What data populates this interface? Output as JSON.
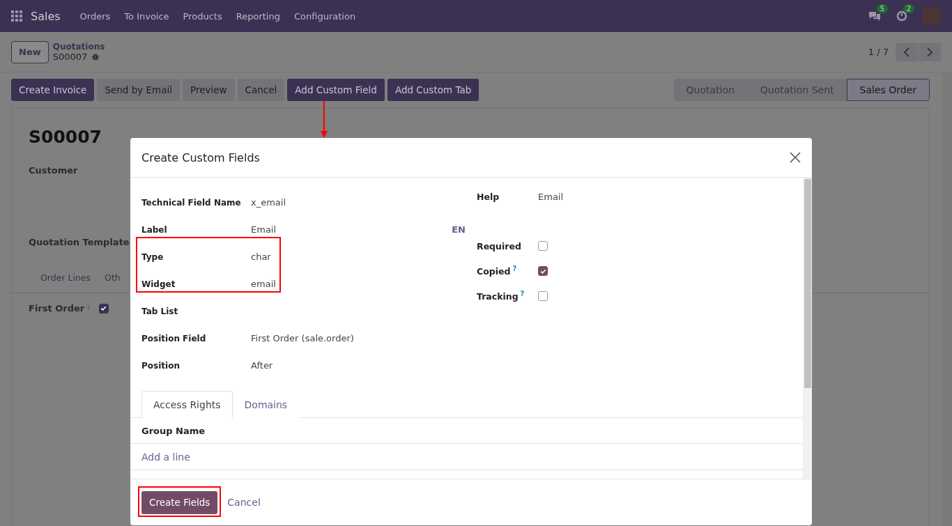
{
  "navbar": {
    "app": "Sales",
    "menu": [
      "Orders",
      "To Invoice",
      "Products",
      "Reporting",
      "Configuration"
    ],
    "messages_count": "5",
    "activities_count": "2"
  },
  "breadcrumb": {
    "new_button": "New",
    "parent": "Quotations",
    "record": "S00007"
  },
  "pager": {
    "value": "1 / 7"
  },
  "action_buttons": [
    {
      "label": "Create Invoice",
      "kind": "primary"
    },
    {
      "label": "Send by Email",
      "kind": "secondary"
    },
    {
      "label": "Preview",
      "kind": "secondary"
    },
    {
      "label": "Cancel",
      "kind": "secondary"
    },
    {
      "label": "Add Custom Field",
      "kind": "primary"
    },
    {
      "label": "Add Custom Tab",
      "kind": "primary"
    }
  ],
  "statusbar": [
    {
      "label": "Quotation",
      "selected": false
    },
    {
      "label": "Quotation Sent",
      "selected": false
    },
    {
      "label": "Sales Order",
      "selected": true
    }
  ],
  "form": {
    "title": "S00007",
    "fields": [
      "Customer",
      "Quotation Template"
    ],
    "tabs": [
      "Order Lines",
      "Oth"
    ],
    "first_order": {
      "label": "First Order",
      "help": "?",
      "checked": true
    }
  },
  "dialog": {
    "title": "Create Custom Fields",
    "fields": [
      {
        "label": "Technical Field Name",
        "value": "x_email"
      },
      {
        "label": "Label",
        "value": "Email",
        "lang": "EN"
      },
      {
        "label": "Type",
        "value": "char"
      },
      {
        "label": "Widget",
        "value": "email"
      },
      {
        "label": "Tab List"
      },
      {
        "label": "Position Field",
        "value": "First Order (sale.order)"
      },
      {
        "label": "Position",
        "value": "After"
      }
    ],
    "help": {
      "label": "Help",
      "value": "Email"
    },
    "toggles": [
      {
        "label": "Required",
        "checked": false
      },
      {
        "label": "Copied",
        "help": "?",
        "checked": true
      },
      {
        "label": "Tracking",
        "help": "?",
        "checked": false
      }
    ],
    "tabs": [
      {
        "label": "Access Rights",
        "selected": true
      },
      {
        "label": "Domains",
        "selected": false
      }
    ],
    "table": {
      "columns": [
        "Group Name"
      ],
      "add_line": "Add a line"
    },
    "buttons": [
      {
        "label": "Create Fields",
        "kind": "primary"
      },
      {
        "label": "Cancel",
        "kind": "link"
      }
    ]
  }
}
